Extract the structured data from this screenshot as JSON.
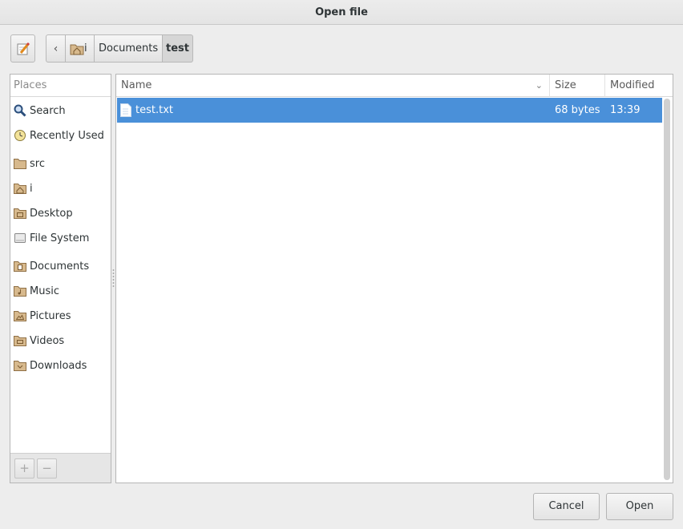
{
  "window": {
    "title": "Open file"
  },
  "pathbar": {
    "home_label": "i",
    "crumbs": [
      "Documents",
      "test"
    ]
  },
  "sidebar": {
    "header": "Places",
    "items": [
      {
        "label": "Search",
        "icon": "search-icon"
      },
      {
        "label": "Recently Used",
        "icon": "clock-icon"
      },
      {
        "label": "src",
        "icon": "folder-icon"
      },
      {
        "label": "i",
        "icon": "home-folder-icon"
      },
      {
        "label": "Desktop",
        "icon": "desktop-folder-icon"
      },
      {
        "label": "File System",
        "icon": "drive-icon"
      },
      {
        "label": "Documents",
        "icon": "documents-folder-icon"
      },
      {
        "label": "Music",
        "icon": "music-folder-icon"
      },
      {
        "label": "Pictures",
        "icon": "pictures-folder-icon"
      },
      {
        "label": "Videos",
        "icon": "videos-folder-icon"
      },
      {
        "label": "Downloads",
        "icon": "downloads-folder-icon"
      }
    ],
    "add_label": "+",
    "remove_label": "−"
  },
  "filelist": {
    "columns": {
      "name": "Name",
      "size": "Size",
      "modified": "Modified"
    },
    "rows": [
      {
        "name": "test.txt",
        "size": "68 bytes",
        "modified": "13:39",
        "selected": true
      }
    ]
  },
  "buttons": {
    "cancel": "Cancel",
    "open": "Open"
  },
  "colors": {
    "selection": "#4a90d9",
    "folder": "#c9a57a"
  }
}
